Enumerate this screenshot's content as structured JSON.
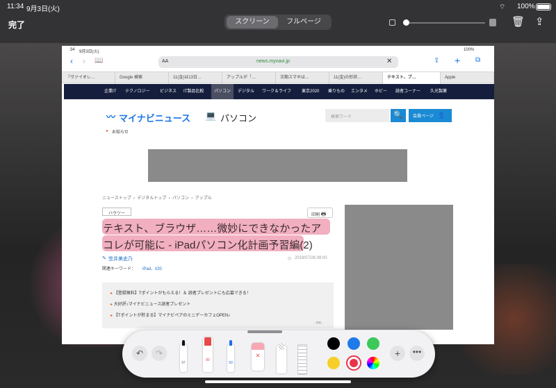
{
  "status_bar": {
    "time": "11:34",
    "date": "9月3日(火)",
    "battery": "100%"
  },
  "toolbar": {
    "done_label": "完了",
    "segments": [
      "スクリーン",
      "フルページ"
    ]
  },
  "browser": {
    "status_time": "11:34",
    "status_date": "9月3日(火)",
    "status_battery": "100%",
    "text_size_label": "AA",
    "url": "news.mynavi.jp",
    "tabs": [
      "『ヴァイオレ…",
      "Google 検索",
      "11(金)は13日…",
      "アップルが「…",
      "次期スマホは…",
      "11(金)の形状…",
      "テキスト、ブ…",
      "Apple"
    ]
  },
  "site": {
    "nav": [
      "企業IT",
      "テクノロジー",
      "ビジネス",
      "IT製品比較",
      "パソコン",
      "デジタル",
      "ワーク＆ライフ",
      "東京2020",
      "乗りもの",
      "エンタメ",
      "ホビー",
      "読者コーナー",
      "久光製薬"
    ],
    "logo": "マイナビニュース",
    "section": "パソコン",
    "notice": "お知らせ",
    "search_placeholder": "検索ワード",
    "member_label": "会員ページ",
    "breadcrumb": [
      "ニューストップ",
      "デジタルトップ",
      "パソコン",
      "アップル"
    ],
    "category": "ハウツー",
    "print_label": "印刷",
    "title_line1": "テキスト、ブラウザ……微妙にできなかったア",
    "title_line2": "コレが可能に - iPadパソコン化計画予習編(2)",
    "author": "笠井美史乃",
    "date": "2019/07/26 08:00",
    "keywords_label": "関連キーワード：",
    "keywords": "iPad、iOS",
    "promos": [
      "【登録無料】Tポイントがもらえる！＆ 読者プレゼントにも応募できる！",
      "大好評♪マイナビニュース読者プレゼント",
      "【Tポイントが貯まる】マイナビペアのミニゲーカフェOPEN♪"
    ],
    "pr_label": "- PR -"
  },
  "markup": {
    "tools": [
      {
        "name": "pen",
        "label": "97"
      },
      {
        "name": "marker",
        "label": "80"
      },
      {
        "name": "pencil",
        "label": "50"
      }
    ],
    "colors": [
      "#000000",
      "#1f7bea",
      "#3cc85a",
      "#f6cf2a",
      "#e8334a"
    ]
  }
}
